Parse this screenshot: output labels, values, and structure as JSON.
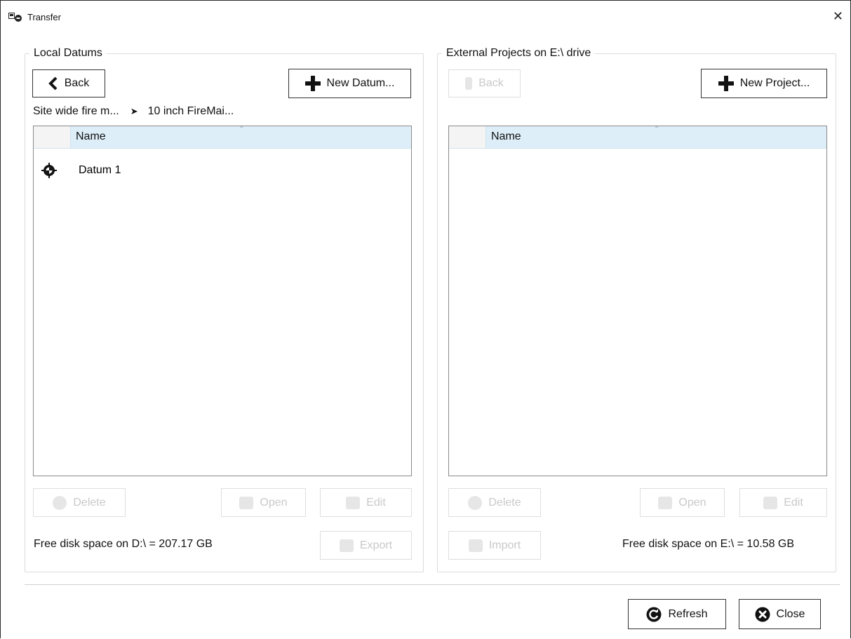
{
  "window": {
    "title": "Transfer"
  },
  "left": {
    "group_title": "Local Datums",
    "back_label": "Back",
    "new_label": "New Datum...",
    "breadcrumb": [
      "Site wide fire m...",
      "10 inch FireMai..."
    ],
    "breadcrumb_separator": "➤",
    "column_header": "Name",
    "items": [
      {
        "label": "Datum 1",
        "icon": "crosshair-icon"
      }
    ],
    "delete_label": "Delete",
    "open_label": "Open",
    "edit_label": "Edit",
    "export_label": "Export",
    "disk_space": "Free disk space on D:\\ = 207.17 GB"
  },
  "right": {
    "group_title": "External Projects on E:\\ drive",
    "back_label": "Back",
    "new_label": "New Project...",
    "column_header": "Name",
    "items": [],
    "delete_label": "Delete",
    "open_label": "Open",
    "edit_label": "Edit",
    "import_label": "Import",
    "disk_space": "Free disk space on E:\\ = 10.58 GB"
  },
  "footer": {
    "refresh_label": "Refresh",
    "close_label": "Close"
  }
}
